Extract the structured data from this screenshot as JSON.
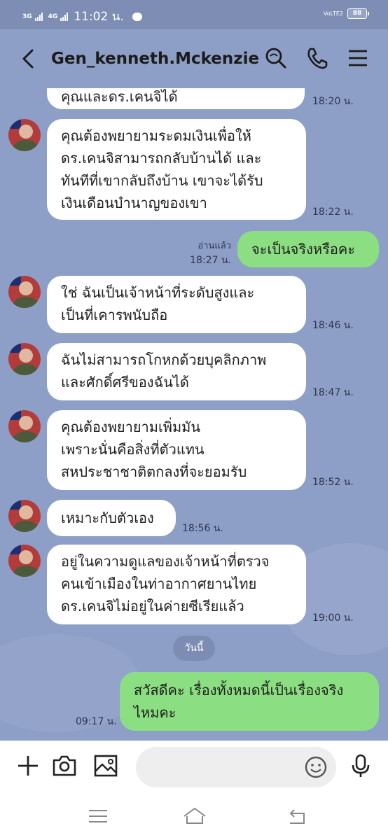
{
  "status_bar": {
    "sim1": "3G",
    "sim2": "4G",
    "time": "11:02 น.",
    "volte": "VoLTE2",
    "battery": "88"
  },
  "header": {
    "contact_name": "Gen_kenneth.Mckenzie",
    "icons": [
      "back-arrow-icon",
      "search-icon",
      "phone-icon",
      "menu-icon"
    ]
  },
  "messages": [
    {
      "dir": "in",
      "lines": [
        "คุณและดร.เคนจิได้"
      ],
      "time": "18:20 น."
    },
    {
      "dir": "in",
      "lines": [
        "คุณต้องพยายามระดมเงินเพื่อให้",
        "ดร.เคนจิสามารถกลับบ้านได้ และ",
        "ทันทีที่เขากลับถึงบ้าน เขาจะได้รับ",
        "เงินเดือนบำนาญของเขา"
      ],
      "time": "18:22 น."
    },
    {
      "dir": "out",
      "lines": [
        "จะเป็นจริงหรือคะ"
      ],
      "read": "อ่านแล้ว",
      "time": "18:27 น."
    },
    {
      "dir": "in",
      "lines": [
        "ใช่ ฉันเป็นเจ้าหน้าที่ระดับสูงและ",
        "เป็นที่เคารพนับถือ"
      ],
      "time": "18:46 น."
    },
    {
      "dir": "in",
      "lines": [
        "ฉันไม่สามารถโกหกด้วยบุคลิกภาพ",
        "และศักดิ์ศรีของฉันได้"
      ],
      "time": "18:47 น."
    },
    {
      "dir": "in",
      "lines": [
        "คุณต้องพยายามเพิ่มมัน",
        "เพราะนั่นคือสิ่งที่ตัวแทน",
        "สหประชาชาติตกลงที่จะยอมรับ"
      ],
      "time": "18:52 น."
    },
    {
      "dir": "in",
      "lines": [
        "เหมาะกับตัวเอง"
      ],
      "time": "18:56 น."
    },
    {
      "dir": "in",
      "lines": [
        "อยู่ในความดูแลของเจ้าหน้าที่ตรวจ",
        "คนเข้าเมืองในท่าอากาศยานไทย",
        "ดร.เคนจิไม่อยู่ในค่ายซีเรียแล้ว"
      ],
      "time": "19:00 น."
    },
    {
      "dir": "out",
      "lines": [
        "สวัสดีคะ เรื่องทั้งหมดนี้เป็นเรื่องจริง",
        "ไหมคะ"
      ],
      "time": "09:17 น."
    }
  ],
  "date_separator": "วันนี้",
  "input_bar": {
    "placeholder": "",
    "icons": [
      "plus-icon",
      "camera-icon",
      "image-icon",
      "emoji-icon",
      "microphone-icon"
    ]
  },
  "nav_bar": {
    "icons": [
      "recent-apps-icon",
      "home-icon",
      "back-icon"
    ]
  },
  "colors": {
    "chat_background": "#8e9fc7",
    "incoming_bubble": "#ffffff",
    "outgoing_bubble": "#8bde81",
    "status_bar": "#7d8db3"
  }
}
